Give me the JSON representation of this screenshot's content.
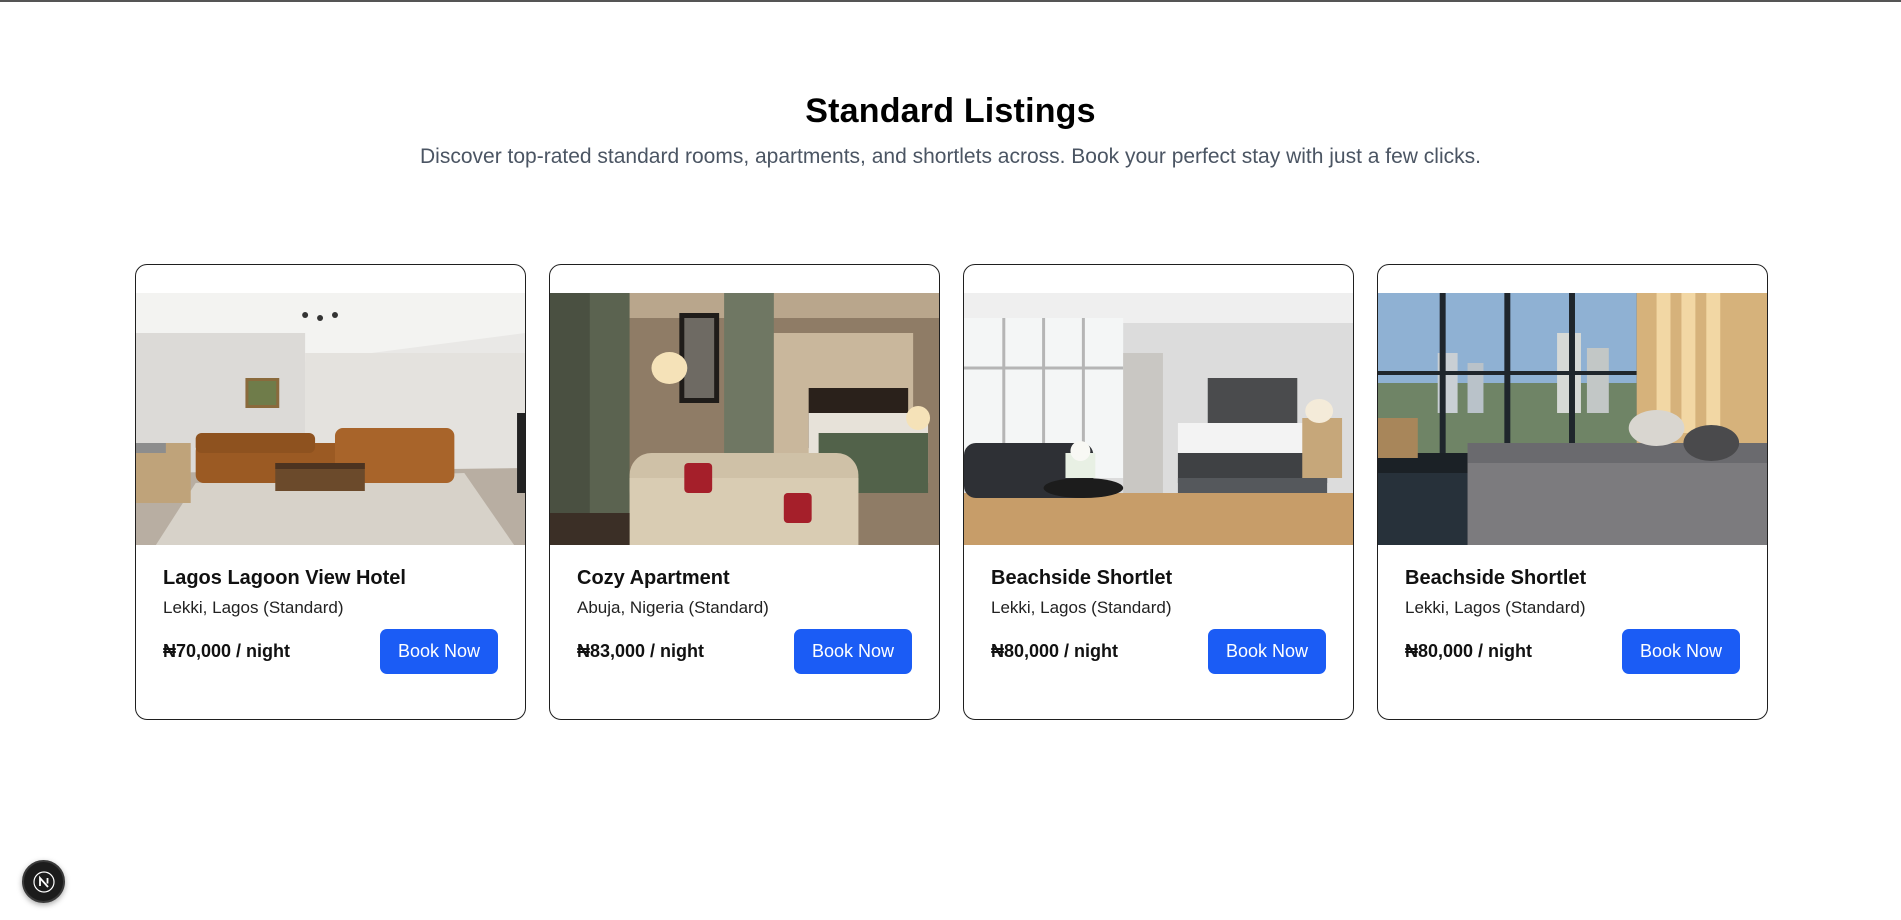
{
  "header": {
    "title": "Standard Listings",
    "subtitle": "Discover top-rated standard rooms, apartments, and shortlets across. Book your perfect stay with just a few clicks."
  },
  "listings": [
    {
      "title": "Lagos Lagoon View Hotel",
      "location": "Lekki, Lagos (Standard)",
      "price": "₦70,000 / night",
      "button": "Book Now",
      "image": "living-room-photo"
    },
    {
      "title": "Cozy Apartment",
      "location": "Abuja, Nigeria (Standard)",
      "price": "₦83,000 / night",
      "button": "Book Now",
      "image": "hotel-bedroom-photo"
    },
    {
      "title": "Beachside Shortlet",
      "location": "Lekki, Lagos (Standard)",
      "price": "₦80,000 / night",
      "button": "Book Now",
      "image": "bright-bedroom-photo"
    },
    {
      "title": "Beachside Shortlet",
      "location": "Lekki, Lagos (Standard)",
      "price": "₦80,000 / night",
      "button": "Book Now",
      "image": "city-view-bedroom-photo"
    }
  ],
  "dev_badge": {
    "letter": "N",
    "icon": "nextjs-icon"
  },
  "colors": {
    "button": "#1b5cf5",
    "subtitle": "#4b5563",
    "card_border": "#1f1f1f"
  }
}
